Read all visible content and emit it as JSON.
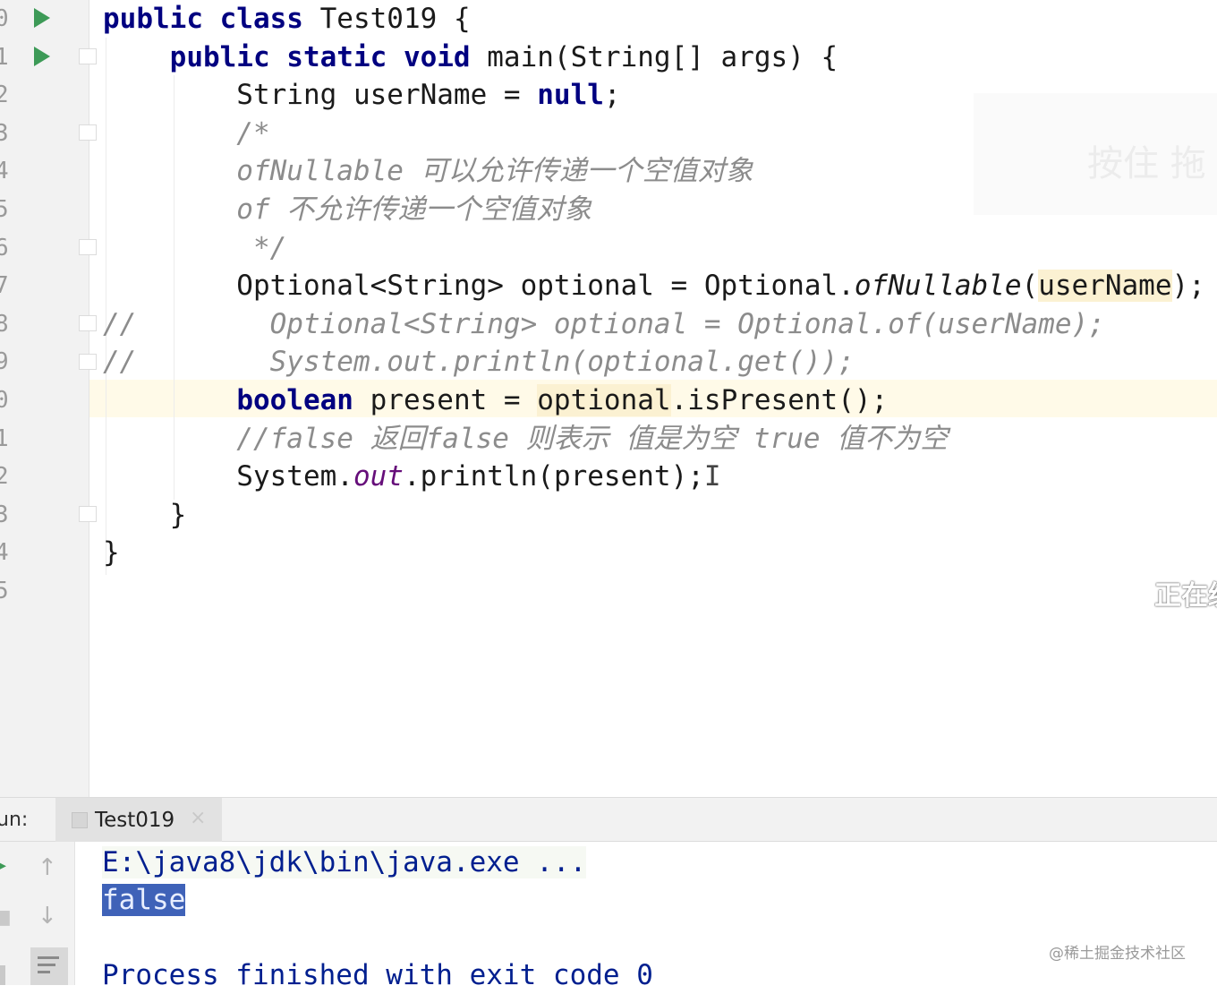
{
  "editor": {
    "line_numbers": [
      "0",
      "1",
      "2",
      "3",
      "4",
      "5",
      "6",
      "7",
      "8",
      "9",
      "0",
      "1",
      "2",
      "3",
      "4",
      "5"
    ],
    "lines": [
      {
        "segs": [
          {
            "t": "public class ",
            "c": "kw"
          },
          {
            "t": "Test019 {",
            "c": ""
          }
        ]
      },
      {
        "segs": [
          {
            "t": "    public static void ",
            "c": "kw"
          },
          {
            "t": "main(String[] args) {",
            "c": ""
          }
        ]
      },
      {
        "segs": [
          {
            "t": "        String userName = ",
            "c": ""
          },
          {
            "t": "null",
            "c": "kw"
          },
          {
            "t": ";",
            "c": ""
          }
        ]
      },
      {
        "segs": [
          {
            "t": "        /*",
            "c": "cm"
          }
        ]
      },
      {
        "segs": [
          {
            "t": "        ofNullable 可以允许传递一个空值对象",
            "c": "cm"
          }
        ]
      },
      {
        "segs": [
          {
            "t": "        of 不允许传递一个空值对象",
            "c": "cm"
          }
        ]
      },
      {
        "segs": [
          {
            "t": "         */",
            "c": "cm"
          }
        ]
      },
      {
        "segs": [
          {
            "t": "        Optional<String> optional = Optional.",
            "c": ""
          },
          {
            "t": "ofNullable",
            "c": "it"
          },
          {
            "t": "(",
            "c": ""
          },
          {
            "t": "userName",
            "c": "hl"
          },
          {
            "t": ");",
            "c": ""
          }
        ]
      },
      {
        "segs": [
          {
            "t": "//        Optional<String> optional = Optional.of(userName);",
            "c": "cm"
          }
        ]
      },
      {
        "segs": [
          {
            "t": "//        System.out.println(optional.get());",
            "c": "cm"
          }
        ]
      },
      {
        "segs": [
          {
            "t": "        ",
            "c": ""
          },
          {
            "t": "boolean ",
            "c": "kw"
          },
          {
            "t": "present = ",
            "c": ""
          },
          {
            "t": "optional",
            "c": "hl"
          },
          {
            "t": ".isPresent();",
            "c": ""
          }
        ]
      },
      {
        "segs": [
          {
            "t": "        //false 返回false 则表示 值是为空 true 值不为空",
            "c": "cm"
          }
        ]
      },
      {
        "segs": [
          {
            "t": "        System.",
            "c": ""
          },
          {
            "t": "out",
            "c": "st"
          },
          {
            "t": ".println(present);",
            "c": ""
          },
          {
            "t": "I",
            "c": "cursor-mark"
          }
        ]
      },
      {
        "segs": [
          {
            "t": "    }",
            "c": ""
          }
        ]
      },
      {
        "segs": [
          {
            "t": "}",
            "c": ""
          }
        ]
      }
    ]
  },
  "overlay": {
    "partial_button_text": "按住 拖",
    "partial_status_text": "正在缓"
  },
  "run_panel": {
    "label": "un:",
    "tab_label": "Test019",
    "tab_close": "×",
    "rerun_icon": "▸",
    "stop_icon": "■",
    "up_icon": "↑",
    "down_icon": "↓",
    "wrap_icon": "soft-wrap-icon"
  },
  "console": {
    "path_line": "E:\\java8\\jdk\\bin\\java.exe ...",
    "output_value": "false",
    "exit_line": "Process finished with exit code 0"
  },
  "watermark": "@稀土掘金技术社区",
  "colors": {
    "keyword": "#000080",
    "comment": "#8c8c8c",
    "static_field": "#660e7a",
    "console_text": "#001f8f",
    "selection": "#3f62b8",
    "run_icon": "#3d9a57"
  }
}
